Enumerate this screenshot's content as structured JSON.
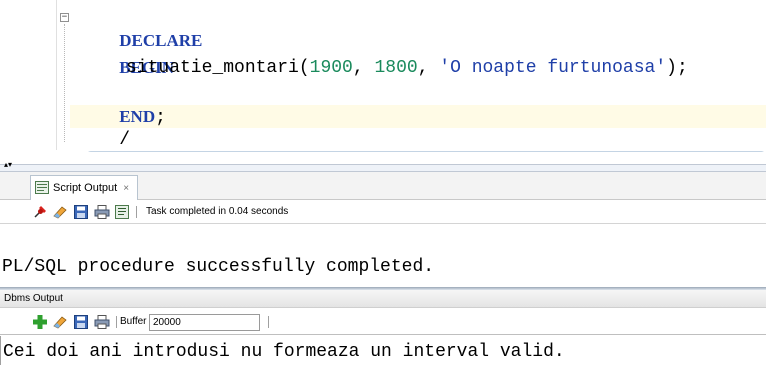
{
  "editor": {
    "lines": [
      {
        "keyword": "DECLARE"
      },
      {
        "keyword": "BEGIN"
      },
      {
        "proc": "situatie_montari(",
        "arg1": "1900",
        "comma1": ", ",
        "arg2": "1800",
        "comma2": ", ",
        "arg3": "'O noapte furtunoasa'",
        "tail": ");"
      },
      {
        "keyword": "END",
        "tail": ";"
      },
      {
        "text": "/"
      }
    ],
    "scroll_arrow": "◂"
  },
  "splitter": {
    "arrows": "▴▾"
  },
  "script_output": {
    "tab_label": "Script Output",
    "tab_close": "×",
    "status": "Task completed in 0.04 seconds",
    "output_text": "PL/SQL procedure successfully completed."
  },
  "dbms_output": {
    "header": "Dbms Output",
    "buffer_label": "Buffer Size:",
    "buffer_value": "20000",
    "output_text": "Cei doi ani introdusi nu formeaza un interval valid."
  },
  "colors": {
    "keyword": "#1f3fa8",
    "number": "#1a8a5c",
    "string": "#1f3fa8",
    "current_line": "#fffbe6"
  },
  "icons": {
    "fold": "collapse-fold-icon",
    "tab": "script-output-icon",
    "pin": "pin-icon",
    "eraser": "clear-eraser-icon",
    "save": "save-disk-icon",
    "print": "print-icon",
    "document": "document-icon",
    "enable": "enable-plus-icon"
  }
}
